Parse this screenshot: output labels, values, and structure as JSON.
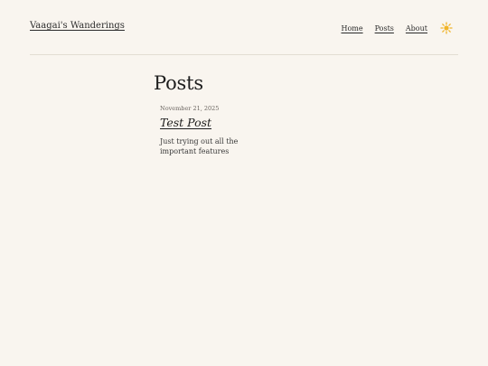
{
  "header": {
    "site_title": "Vaagai's Wanderings",
    "nav": [
      {
        "label": "Home"
      },
      {
        "label": "Posts"
      },
      {
        "label": "About"
      }
    ],
    "theme_toggle_icon": "sun-icon",
    "accent_color": "#f0b429"
  },
  "main": {
    "page_title": "Posts",
    "posts": [
      {
        "date": "November 21, 2025",
        "title": "Test Post",
        "excerpt": "Just trying out all the important features"
      }
    ]
  }
}
